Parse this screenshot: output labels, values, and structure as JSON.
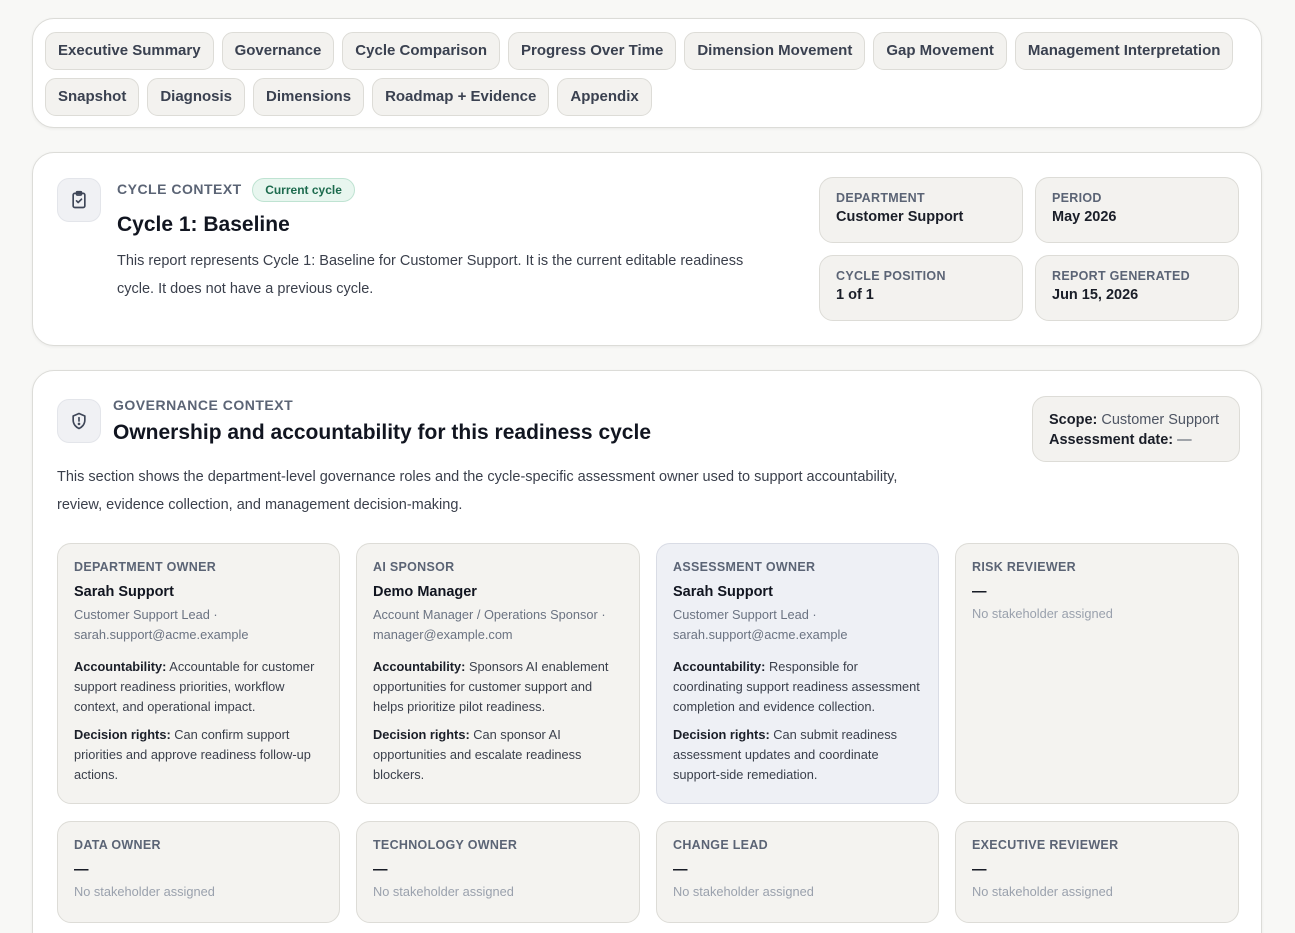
{
  "nav": {
    "row1": [
      "Executive Summary",
      "Governance",
      "Cycle Comparison",
      "Progress Over Time",
      "Dimension Movement",
      "Gap Movement",
      "Management Interpretation"
    ],
    "row2": [
      "Snapshot",
      "Diagnosis",
      "Dimensions",
      "Roadmap + Evidence",
      "Appendix"
    ]
  },
  "cycle": {
    "eyebrow": "Cycle context",
    "badge": "Current cycle",
    "title": "Cycle 1: Baseline",
    "description_line1": "This report represents Cycle 1: Baseline for Customer Support. It is the current editable readiness",
    "description_line2": "cycle. It does not have a previous cycle.",
    "icon": "clipboard-check-icon",
    "meta": {
      "department_label": "Department",
      "department_value": "Customer Support",
      "period_label": "Period",
      "period_value": "May 2026",
      "position_label": "Cycle position",
      "position_value": "1 of 1",
      "generated_label": "Report generated",
      "generated_value": "Jun 15, 2026"
    }
  },
  "governance": {
    "eyebrow": "Governance context",
    "title": "Ownership and accountability for this readiness cycle",
    "icon": "shield-icon",
    "description_line1": "This section shows the department-level governance roles and the cycle-specific assessment owner used to support accountability,",
    "description_line2": "review, evidence collection, and management decision-making.",
    "scope_label": "Scope:",
    "scope_value": "Customer Support",
    "date_label": "Assessment date:",
    "date_value": "—",
    "accountability_label": "Accountability:",
    "decision_label": "Decision rights:",
    "stakeholders": [
      {
        "role": "Department owner",
        "name": "Sarah Support",
        "title_line": "Customer Support Lead ·",
        "email": "sarah.support@acme.example",
        "accountability": "Accountable for customer support readiness priorities, workflow context, and operational impact.",
        "decision_rights": "Can confirm support priorities and approve readiness follow-up actions."
      },
      {
        "role": "AI sponsor",
        "name": "Demo Manager",
        "title_line": "Account Manager / Operations Sponsor ·",
        "email": "manager@example.com",
        "accountability": "Sponsors AI enablement opportunities for customer support and helps prioritize pilot readiness.",
        "decision_rights": "Can sponsor AI opportunities and escalate readiness blockers."
      },
      {
        "role": "Assessment owner",
        "name": "Sarah Support",
        "title_line": "Customer Support Lead ·",
        "email": "sarah.support@acme.example",
        "accountability": "Responsible for coordinating support readiness assessment completion and evidence collection.",
        "decision_rights": "Can submit readiness assessment updates and coordinate support-side remediation."
      },
      {
        "role": "Risk reviewer",
        "name": "—",
        "empty": "No stakeholder assigned"
      },
      {
        "role": "Data owner",
        "name": "—",
        "empty": "No stakeholder assigned"
      },
      {
        "role": "Technology owner",
        "name": "—",
        "empty": "No stakeholder assigned"
      },
      {
        "role": "Change lead",
        "name": "—",
        "empty": "No stakeholder assigned"
      },
      {
        "role": "Executive reviewer",
        "name": "—",
        "empty": "No stakeholder assigned"
      }
    ]
  }
}
